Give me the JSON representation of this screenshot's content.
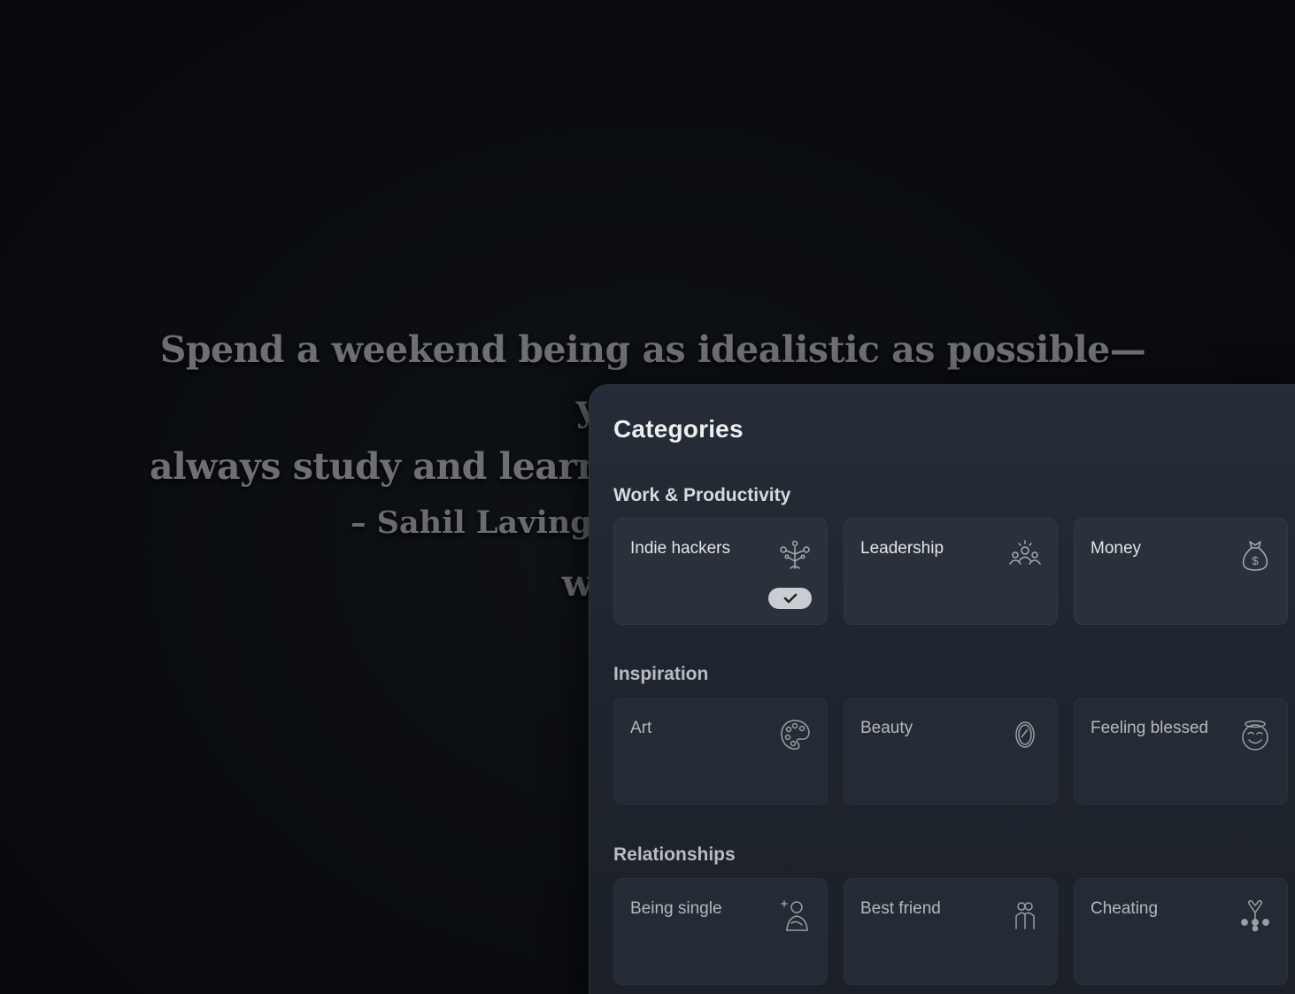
{
  "quote": {
    "line1": "Spend a weekend being as idealistic as possible—you can",
    "line2": "always study and learn later. The best way to learn is",
    "line3": "watching",
    "author": "– Sahil Lavingia"
  },
  "panel": {
    "title": "Categories",
    "sections": [
      {
        "title": "Work & Productivity",
        "cards": [
          {
            "label": "Indie hackers",
            "icon": "indie-hackers-icon",
            "selected": true
          },
          {
            "label": "Leadership",
            "icon": "leadership-icon",
            "selected": false
          },
          {
            "label": "Money",
            "icon": "money-bag-icon",
            "selected": false
          }
        ]
      },
      {
        "title": "Inspiration",
        "cards": [
          {
            "label": "Art",
            "icon": "palette-icon",
            "selected": false
          },
          {
            "label": "Beauty",
            "icon": "mirror-icon",
            "selected": false
          },
          {
            "label": "Feeling blessed",
            "icon": "smile-halo-icon",
            "selected": false
          }
        ]
      },
      {
        "title": "Relationships",
        "cards": [
          {
            "label": "Being single",
            "icon": "single-person-icon",
            "selected": false
          },
          {
            "label": "Best friend",
            "icon": "friends-icon",
            "selected": false
          },
          {
            "label": "Cheating",
            "icon": "broken-heart-icon",
            "selected": false
          }
        ]
      }
    ]
  },
  "colors": {
    "panel_bg": "#262d38",
    "card_bg": "#2a313b",
    "check_badge": "#c9ccd1"
  }
}
